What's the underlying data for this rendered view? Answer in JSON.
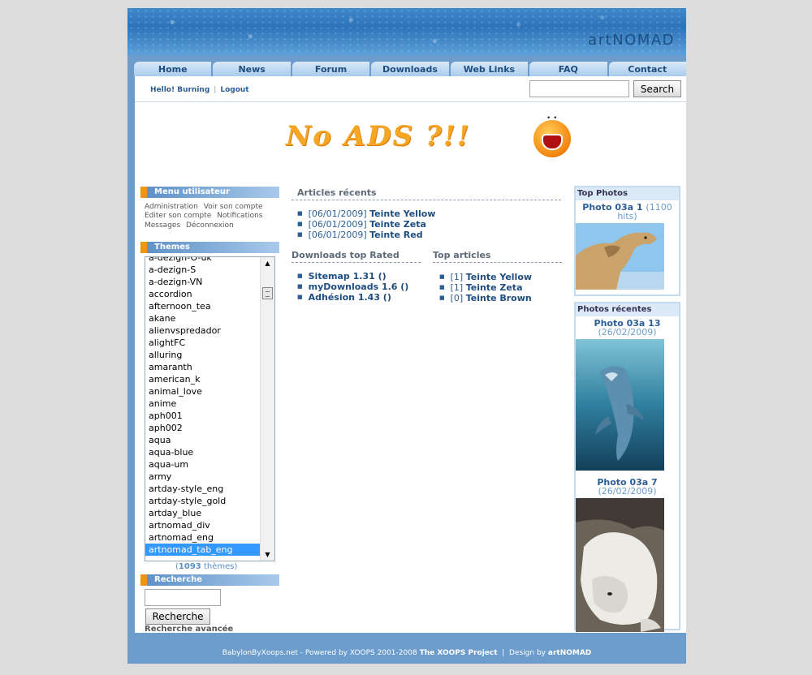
{
  "banner": {
    "logo": "artNOMAD"
  },
  "nav": [
    "Home",
    "News",
    "Forum",
    "Downloads",
    "Web Links",
    "FAQ",
    "Contact"
  ],
  "userbar": {
    "hello": "Hello! Burning",
    "logout": "Logout",
    "search_button": "Search"
  },
  "ad": {
    "text": "No ADS ?!!"
  },
  "user_menu": {
    "title": "Menu utilisateur",
    "items": [
      "Administration",
      "Voir son compte",
      "Editer son compte",
      "Notifications",
      "Messages",
      "Déconnexion"
    ]
  },
  "themes": {
    "title": "Themes",
    "items": [
      "a-dezign-O-uk",
      "a-dezign-S",
      "a-dezign-VN",
      "accordion",
      "afternoon_tea",
      "akane",
      "alienvspredador",
      "alightFC",
      "alluring",
      "amaranth",
      "american_k",
      "animal_love",
      "anime",
      "aph001",
      "aph002",
      "aqua",
      "aqua-blue",
      "aqua-um",
      "army",
      "artday-style_eng",
      "artday-style_gold",
      "artday_blue",
      "artnomad_div",
      "artnomad_eng",
      "artnomad_tab_eng"
    ],
    "selected": "artnomad_tab_eng",
    "count": "1093",
    "count_suffix": "thèmes"
  },
  "recherche": {
    "title": "Recherche",
    "button": "Recherche",
    "advanced": "Recherche avancée"
  },
  "articles_recents": {
    "title": "Articles récents",
    "items": [
      {
        "date": "[06/01/2009]",
        "name": "Teinte Yellow"
      },
      {
        "date": "[06/01/2009]",
        "name": "Teinte Zeta"
      },
      {
        "date": "[06/01/2009]",
        "name": "Teinte Red"
      }
    ]
  },
  "downloads_top": {
    "title": "Downloads top Rated",
    "items": [
      "Sitemap 1.31 ()",
      "myDownloads 1.6 ()",
      "Adhésion 1.43 ()"
    ]
  },
  "top_articles": {
    "title": "Top articles",
    "items": [
      {
        "count": "[1]",
        "name": "Teinte Yellow"
      },
      {
        "count": "[1]",
        "name": "Teinte Zeta"
      },
      {
        "count": "[0]",
        "name": "Teinte Brown"
      }
    ]
  },
  "top_photos": {
    "title": "Top Photos",
    "photo": {
      "name": "Photo 03a 1",
      "meta": "(1100 hits)"
    }
  },
  "photos_recentes": {
    "title": "Photos récentes",
    "photos": [
      {
        "name": "Photo 03a 13",
        "meta": "(26/02/2009)"
      },
      {
        "name": "Photo 03a 7",
        "meta": "(26/02/2009)"
      }
    ]
  },
  "footer": {
    "prefix": "BabylonByXoops.net - Powered by XOOPS 2001-2008",
    "project": "The XOOPS Project",
    "design_prefix": "Design by",
    "designer": "artNOMAD"
  },
  "colors": {
    "accent": "#f29312",
    "link": "#2c5e93",
    "frame": "#6b9ccc"
  }
}
